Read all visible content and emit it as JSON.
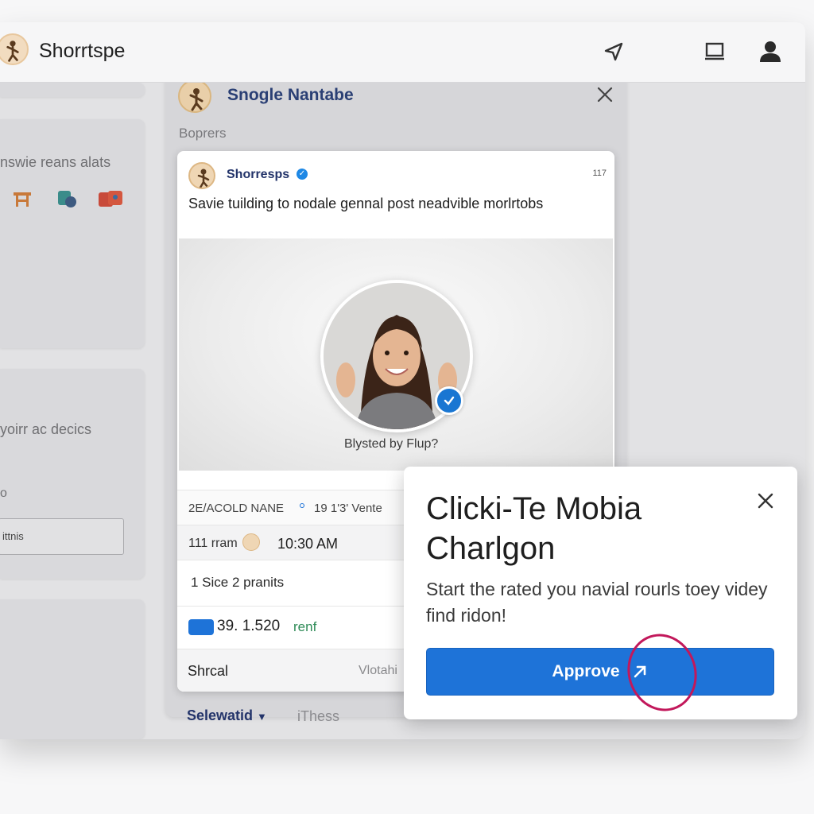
{
  "app": {
    "brand": "Shorrtspe",
    "icons": [
      "send-icon",
      "display-icon",
      "account-icon"
    ]
  },
  "left_column": {
    "card1_text": "nswie reans alats",
    "card2_text": "yoirr ac decics",
    "card2_value": "o",
    "card2_input": "ittnis"
  },
  "mid_panel": {
    "title": "Snogle Nantabe",
    "subtitle": "Boprers"
  },
  "post": {
    "author": "Shorresps",
    "count": "117",
    "text": "Savie tuilding to nodale gennal post neadvible morlrtobs",
    "media_caption": "Blysted by Flup?",
    "meta": {
      "left": "2E/ACOLD NANE",
      "right": "19 1'3' Vente"
    },
    "time_row": {
      "label": "111 rram",
      "time": "10:30 AM"
    },
    "stat1": "1 Sice 2 pranits",
    "stat2_value": "39. 1.520",
    "stat2_unit": "renf",
    "footer_left": "Shrcal",
    "footer_right": "Vlotahi"
  },
  "bottom": {
    "select_label": "Selewatid",
    "tab_label": "iThess"
  },
  "popup": {
    "title": "Clicki-Te Mobia Charlgon",
    "body": "Start the rated you navial rourls toey videy find ridon!",
    "approve_label": "Approve",
    "accent": "#1e73d8"
  }
}
